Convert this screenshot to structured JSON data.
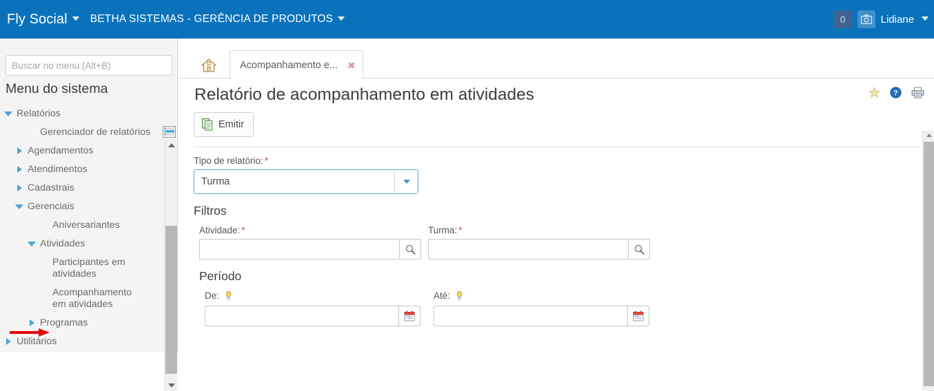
{
  "topbar": {
    "brand": "Fly Social",
    "organization": "BETHA SISTEMAS - GERÊNCIA DE PRODUTOS",
    "notification_count": "0",
    "username": "Lidiane",
    "bg_color": "#0a72bb"
  },
  "sidebar": {
    "search_placeholder": "Buscar no menu (Alt+B)",
    "search_value": "",
    "menu_title": "Menu do sistema",
    "tree": [
      {
        "label": "Relatórios",
        "level": 0,
        "arrow": "down"
      },
      {
        "label": "Gerenciador de relatórios",
        "level": 2,
        "arrow": "none"
      },
      {
        "label": "Agendamentos",
        "level": 1,
        "arrow": "right"
      },
      {
        "label": "Atendimentos",
        "level": 1,
        "arrow": "right"
      },
      {
        "label": "Cadastrais",
        "level": 1,
        "arrow": "right"
      },
      {
        "label": "Gerenciais",
        "level": 1,
        "arrow": "down"
      },
      {
        "label": "Aniversariantes",
        "level": 3,
        "arrow": "none"
      },
      {
        "label": "Atividades",
        "level": 2,
        "arrow": "down"
      },
      {
        "label": "Participantes em atividades",
        "level": 3,
        "arrow": "none"
      },
      {
        "label": "Acompanhamento em atividades",
        "level": 3,
        "arrow": "none"
      },
      {
        "label": "Programas",
        "level": 2,
        "arrow": "right"
      },
      {
        "label": "Utilitários",
        "level": 0,
        "arrow": "right"
      }
    ]
  },
  "tabs": {
    "home_tab": "home-icon",
    "active_tab_label": "Acompanhamento e...",
    "close_glyph": "✖"
  },
  "page": {
    "title": "Relatório de acompanhamento em atividades",
    "icons": [
      "favorite-star-icon",
      "help-icon",
      "print-icon"
    ]
  },
  "toolbar": {
    "emitir_label": "Emitir"
  },
  "form": {
    "tipo_relatorio": {
      "label": "Tipo de relatório:",
      "required": "*",
      "value": "Turma",
      "placeholder": ""
    },
    "filtros_heading": "Filtros",
    "atividade": {
      "label": "Atividade:",
      "required": "*",
      "value": "",
      "placeholder": ""
    },
    "turma": {
      "label": "Turma:",
      "required": "*",
      "value": "",
      "placeholder": ""
    },
    "periodo_heading": "Período",
    "de": {
      "label": "De:",
      "value": "",
      "placeholder": ""
    },
    "ate": {
      "label": "Até:",
      "value": "",
      "placeholder": ""
    }
  },
  "annotation": {
    "arrow_color": "#e60000",
    "points_to": "Acompanhamento em atividades"
  }
}
